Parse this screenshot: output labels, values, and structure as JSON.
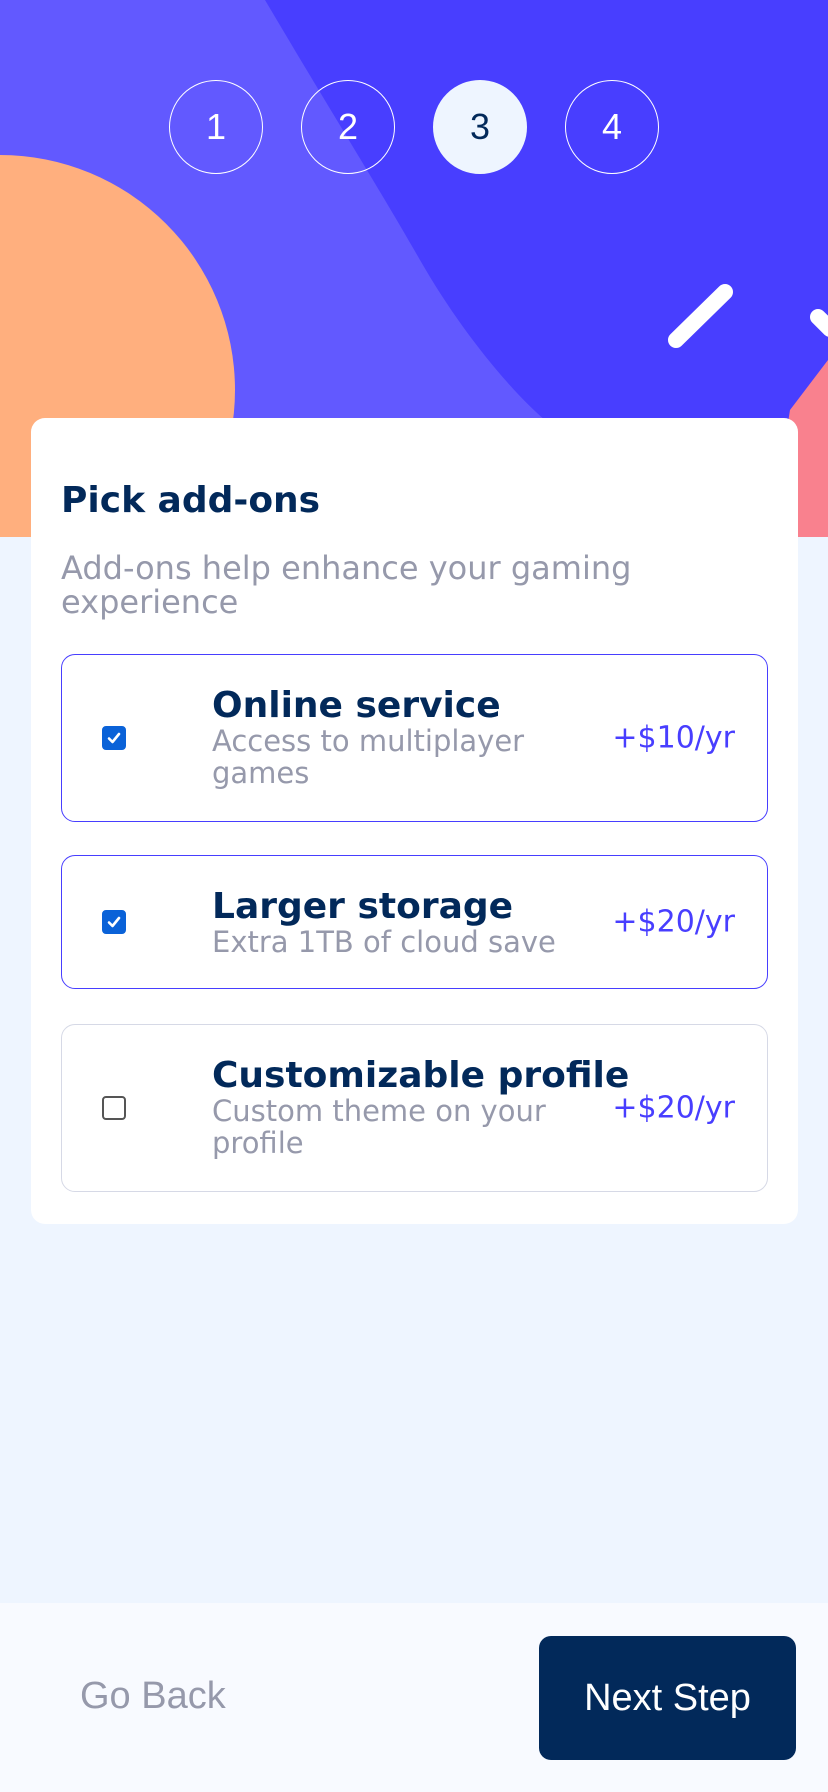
{
  "colors": {
    "hero_blue": "#483eff",
    "hero_light_blue": "#6259ff",
    "hero_orange": "#ffaf7e",
    "hero_pink": "#f9818e",
    "marine_blue": "#02295a",
    "cool_gray": "#9699ab",
    "purplish_blue": "#483eff",
    "background": "#eef5ff"
  },
  "steps": [
    {
      "number": "1",
      "active": false
    },
    {
      "number": "2",
      "active": false
    },
    {
      "number": "3",
      "active": true
    },
    {
      "number": "4",
      "active": false
    }
  ],
  "form": {
    "title": "Pick add-ons",
    "subtitle": "Add-ons help enhance your gaming experience"
  },
  "addons": [
    {
      "name": "Online service",
      "description": "Access to multiplayer games",
      "price": "+$10/yr",
      "checked": true
    },
    {
      "name": "Larger storage",
      "description": "Extra 1TB of cloud save",
      "price": "+$20/yr",
      "checked": true
    },
    {
      "name": "Customizable profile",
      "description": "Custom theme on your profile",
      "price": "+$20/yr",
      "checked": false
    }
  ],
  "footer": {
    "back_label": "Go Back",
    "next_label": "Next Step"
  },
  "icons": {
    "checkbox_checked": "check-icon"
  }
}
